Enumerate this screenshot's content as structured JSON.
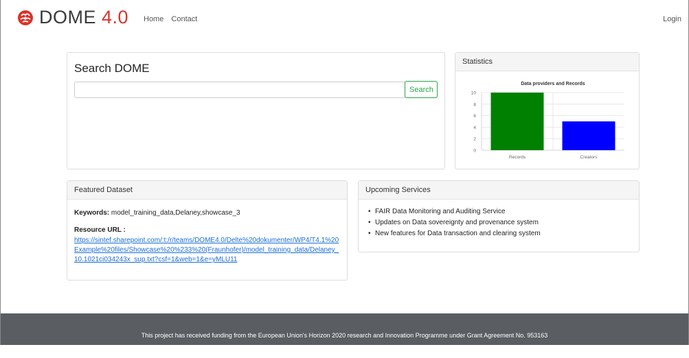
{
  "header": {
    "logo_text": "DOME ",
    "logo_version": "4.0",
    "nav": [
      "Home",
      "Contact"
    ],
    "login": "Login"
  },
  "search": {
    "title": "Search DOME",
    "input_value": "",
    "button_label": "Search"
  },
  "statistics": {
    "header": "Statistics"
  },
  "chart_data": {
    "type": "bar",
    "title": "Data providers and Records",
    "categories": [
      "Records",
      "Creators"
    ],
    "values": [
      10,
      5
    ],
    "colors": [
      "#008000",
      "#0000ff"
    ],
    "ylim": [
      0,
      10
    ],
    "yticks": [
      0,
      2,
      4,
      6,
      8,
      10
    ],
    "grid": true
  },
  "featured": {
    "header": "Featured Dataset",
    "keywords_label": "Keywords:",
    "keywords": "model_training_data,Delaney,showcase_3",
    "resource_label": "Resource URL :",
    "resource_url": "https://sintef.sharepoint.com/:t:/r/teams/DOME4.0/Delte%20dokumenter/WP4/T4.1%20Example%20files/Showcase%20%233%20(Fraunhofer)/model_training_data/Delaney_10.1021ci034243x_sup.txt?csf=1&web=1&e=yMLU11"
  },
  "upcoming": {
    "header": "Upcoming Services",
    "items": [
      "FAIR Data Monitoring and Auditing Service",
      "Updates on Data sovereignty and provenance system",
      "New features for Data transaction and clearing system"
    ]
  },
  "footer": {
    "text": "This project has received funding from the European Union's Horizon 2020 research and Innovation Programme under Grant Agreement No. 953163"
  }
}
